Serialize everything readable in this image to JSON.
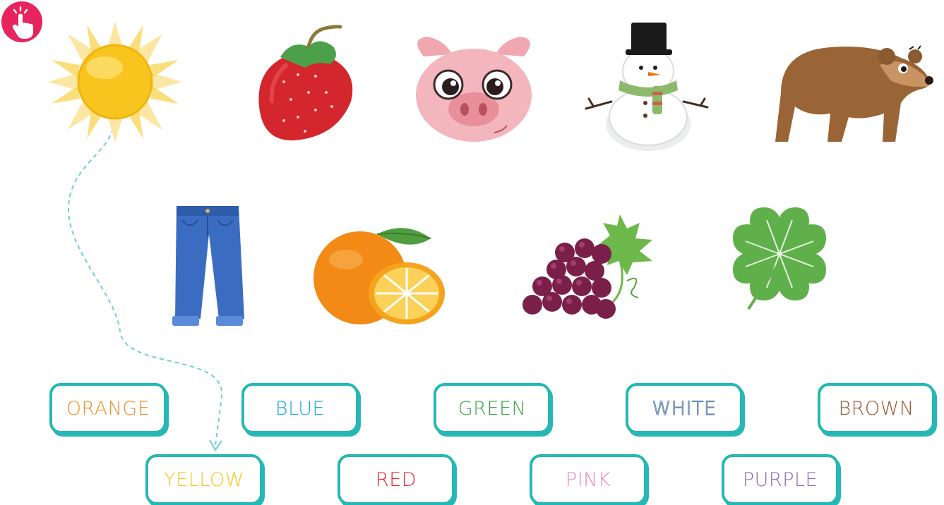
{
  "activity": {
    "pictures": [
      {
        "name": "sun",
        "icon": "sun-icon"
      },
      {
        "name": "strawberry",
        "icon": "strawberry-icon"
      },
      {
        "name": "pig",
        "icon": "pig-face-icon"
      },
      {
        "name": "snowman",
        "icon": "snowman-icon"
      },
      {
        "name": "bear",
        "icon": "bear-icon"
      },
      {
        "name": "jeans",
        "icon": "jeans-icon"
      },
      {
        "name": "orange",
        "icon": "orange-fruit-icon"
      },
      {
        "name": "grapes",
        "icon": "grapes-icon"
      },
      {
        "name": "clover",
        "icon": "four-leaf-clover-icon"
      }
    ],
    "words_row1": [
      {
        "label": "ORANGE",
        "color": "#f0922b"
      },
      {
        "label": "BLUE",
        "color": "#1aa5e0"
      },
      {
        "label": "GREEN",
        "color": "#3aa64a"
      },
      {
        "label": "WHITE",
        "color": "#ffffff"
      },
      {
        "label": "BROWN",
        "color": "#9a5434"
      }
    ],
    "words_row2": [
      {
        "label": "YELLOW",
        "color": "#f7c51e"
      },
      {
        "label": "RED",
        "color": "#e52629"
      },
      {
        "label": "PINK",
        "color": "#f184b5"
      },
      {
        "label": "PURPLE",
        "color": "#8b6bb1"
      }
    ],
    "example_match": {
      "from": "sun",
      "to": "YELLOW"
    },
    "colors": {
      "tile_border": "#25b8b5",
      "tap_badge": "#e8245f",
      "trace_line": "#6fcfd1"
    }
  }
}
